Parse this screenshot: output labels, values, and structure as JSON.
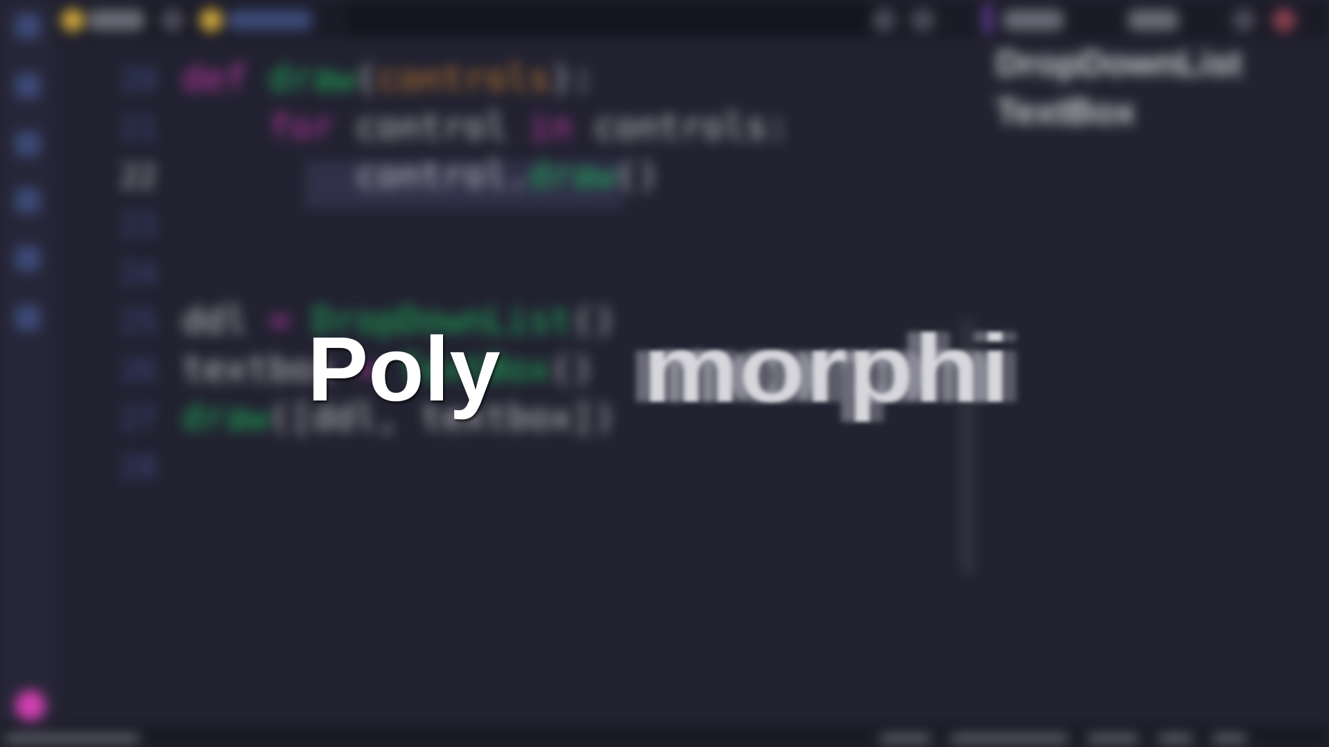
{
  "editor": {
    "line_numbers": [
      "20",
      "21",
      "22",
      "23",
      "24",
      "25",
      "26",
      "27",
      "28"
    ],
    "current_line": "22",
    "code_lines": [
      [
        {
          "t": "def ",
          "c": "kw"
        },
        {
          "t": "draw",
          "c": "fn"
        },
        {
          "t": "(",
          "c": "tx"
        },
        {
          "t": "controls",
          "c": "pa"
        },
        {
          "t": "):",
          "c": "tx"
        }
      ],
      [
        {
          "t": "    for ",
          "c": "kw"
        },
        {
          "t": "control ",
          "c": "tx"
        },
        {
          "t": "in ",
          "c": "kw"
        },
        {
          "t": "controls:",
          "c": "tx"
        }
      ],
      [
        {
          "t": "        control.",
          "c": "tx"
        },
        {
          "t": "draw",
          "c": "fn"
        },
        {
          "t": "()",
          "c": "tx"
        }
      ],
      [],
      [],
      [
        {
          "t": "ddl ",
          "c": "tx"
        },
        {
          "t": "= ",
          "c": "kw"
        },
        {
          "t": "DropDownList",
          "c": "fn"
        },
        {
          "t": "()",
          "c": "tx"
        }
      ],
      [
        {
          "t": "textbox ",
          "c": "tx"
        },
        {
          "t": "= ",
          "c": "kw"
        },
        {
          "t": "TextBox",
          "c": "fn"
        },
        {
          "t": "()",
          "c": "tx"
        }
      ],
      [
        {
          "t": "draw",
          "c": "fn"
        },
        {
          "t": "([ddl, textbox])",
          "c": "tx"
        }
      ],
      []
    ]
  },
  "right_panel": {
    "items": [
      "DropDownList",
      "TextBox"
    ]
  },
  "overlay": {
    "word_left": "Poly",
    "word_right": "morphi"
  },
  "colors": {
    "background": "#222231",
    "keyword": "#c33aa8",
    "function": "#1fb15a",
    "param": "#c77b2f"
  }
}
